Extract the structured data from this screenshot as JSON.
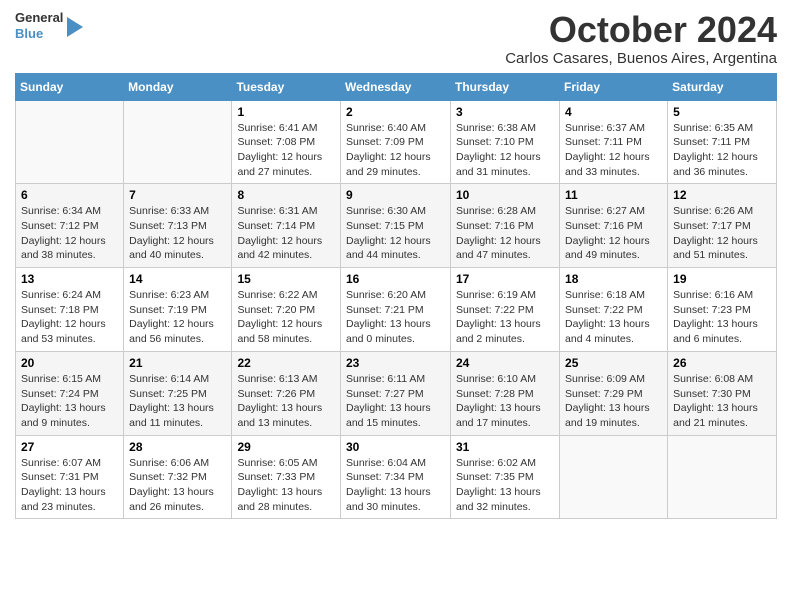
{
  "header": {
    "logo_line1": "General",
    "logo_line2": "Blue",
    "month": "October 2024",
    "location": "Carlos Casares, Buenos Aires, Argentina"
  },
  "days_of_week": [
    "Sunday",
    "Monday",
    "Tuesday",
    "Wednesday",
    "Thursday",
    "Friday",
    "Saturday"
  ],
  "weeks": [
    [
      {
        "day": "",
        "info": ""
      },
      {
        "day": "",
        "info": ""
      },
      {
        "day": "1",
        "info": "Sunrise: 6:41 AM\nSunset: 7:08 PM\nDaylight: 12 hours and 27 minutes."
      },
      {
        "day": "2",
        "info": "Sunrise: 6:40 AM\nSunset: 7:09 PM\nDaylight: 12 hours and 29 minutes."
      },
      {
        "day": "3",
        "info": "Sunrise: 6:38 AM\nSunset: 7:10 PM\nDaylight: 12 hours and 31 minutes."
      },
      {
        "day": "4",
        "info": "Sunrise: 6:37 AM\nSunset: 7:11 PM\nDaylight: 12 hours and 33 minutes."
      },
      {
        "day": "5",
        "info": "Sunrise: 6:35 AM\nSunset: 7:11 PM\nDaylight: 12 hours and 36 minutes."
      }
    ],
    [
      {
        "day": "6",
        "info": "Sunrise: 6:34 AM\nSunset: 7:12 PM\nDaylight: 12 hours and 38 minutes."
      },
      {
        "day": "7",
        "info": "Sunrise: 6:33 AM\nSunset: 7:13 PM\nDaylight: 12 hours and 40 minutes."
      },
      {
        "day": "8",
        "info": "Sunrise: 6:31 AM\nSunset: 7:14 PM\nDaylight: 12 hours and 42 minutes."
      },
      {
        "day": "9",
        "info": "Sunrise: 6:30 AM\nSunset: 7:15 PM\nDaylight: 12 hours and 44 minutes."
      },
      {
        "day": "10",
        "info": "Sunrise: 6:28 AM\nSunset: 7:16 PM\nDaylight: 12 hours and 47 minutes."
      },
      {
        "day": "11",
        "info": "Sunrise: 6:27 AM\nSunset: 7:16 PM\nDaylight: 12 hours and 49 minutes."
      },
      {
        "day": "12",
        "info": "Sunrise: 6:26 AM\nSunset: 7:17 PM\nDaylight: 12 hours and 51 minutes."
      }
    ],
    [
      {
        "day": "13",
        "info": "Sunrise: 6:24 AM\nSunset: 7:18 PM\nDaylight: 12 hours and 53 minutes."
      },
      {
        "day": "14",
        "info": "Sunrise: 6:23 AM\nSunset: 7:19 PM\nDaylight: 12 hours and 56 minutes."
      },
      {
        "day": "15",
        "info": "Sunrise: 6:22 AM\nSunset: 7:20 PM\nDaylight: 12 hours and 58 minutes."
      },
      {
        "day": "16",
        "info": "Sunrise: 6:20 AM\nSunset: 7:21 PM\nDaylight: 13 hours and 0 minutes."
      },
      {
        "day": "17",
        "info": "Sunrise: 6:19 AM\nSunset: 7:22 PM\nDaylight: 13 hours and 2 minutes."
      },
      {
        "day": "18",
        "info": "Sunrise: 6:18 AM\nSunset: 7:22 PM\nDaylight: 13 hours and 4 minutes."
      },
      {
        "day": "19",
        "info": "Sunrise: 6:16 AM\nSunset: 7:23 PM\nDaylight: 13 hours and 6 minutes."
      }
    ],
    [
      {
        "day": "20",
        "info": "Sunrise: 6:15 AM\nSunset: 7:24 PM\nDaylight: 13 hours and 9 minutes."
      },
      {
        "day": "21",
        "info": "Sunrise: 6:14 AM\nSunset: 7:25 PM\nDaylight: 13 hours and 11 minutes."
      },
      {
        "day": "22",
        "info": "Sunrise: 6:13 AM\nSunset: 7:26 PM\nDaylight: 13 hours and 13 minutes."
      },
      {
        "day": "23",
        "info": "Sunrise: 6:11 AM\nSunset: 7:27 PM\nDaylight: 13 hours and 15 minutes."
      },
      {
        "day": "24",
        "info": "Sunrise: 6:10 AM\nSunset: 7:28 PM\nDaylight: 13 hours and 17 minutes."
      },
      {
        "day": "25",
        "info": "Sunrise: 6:09 AM\nSunset: 7:29 PM\nDaylight: 13 hours and 19 minutes."
      },
      {
        "day": "26",
        "info": "Sunrise: 6:08 AM\nSunset: 7:30 PM\nDaylight: 13 hours and 21 minutes."
      }
    ],
    [
      {
        "day": "27",
        "info": "Sunrise: 6:07 AM\nSunset: 7:31 PM\nDaylight: 13 hours and 23 minutes."
      },
      {
        "day": "28",
        "info": "Sunrise: 6:06 AM\nSunset: 7:32 PM\nDaylight: 13 hours and 26 minutes."
      },
      {
        "day": "29",
        "info": "Sunrise: 6:05 AM\nSunset: 7:33 PM\nDaylight: 13 hours and 28 minutes."
      },
      {
        "day": "30",
        "info": "Sunrise: 6:04 AM\nSunset: 7:34 PM\nDaylight: 13 hours and 30 minutes."
      },
      {
        "day": "31",
        "info": "Sunrise: 6:02 AM\nSunset: 7:35 PM\nDaylight: 13 hours and 32 minutes."
      },
      {
        "day": "",
        "info": ""
      },
      {
        "day": "",
        "info": ""
      }
    ]
  ]
}
